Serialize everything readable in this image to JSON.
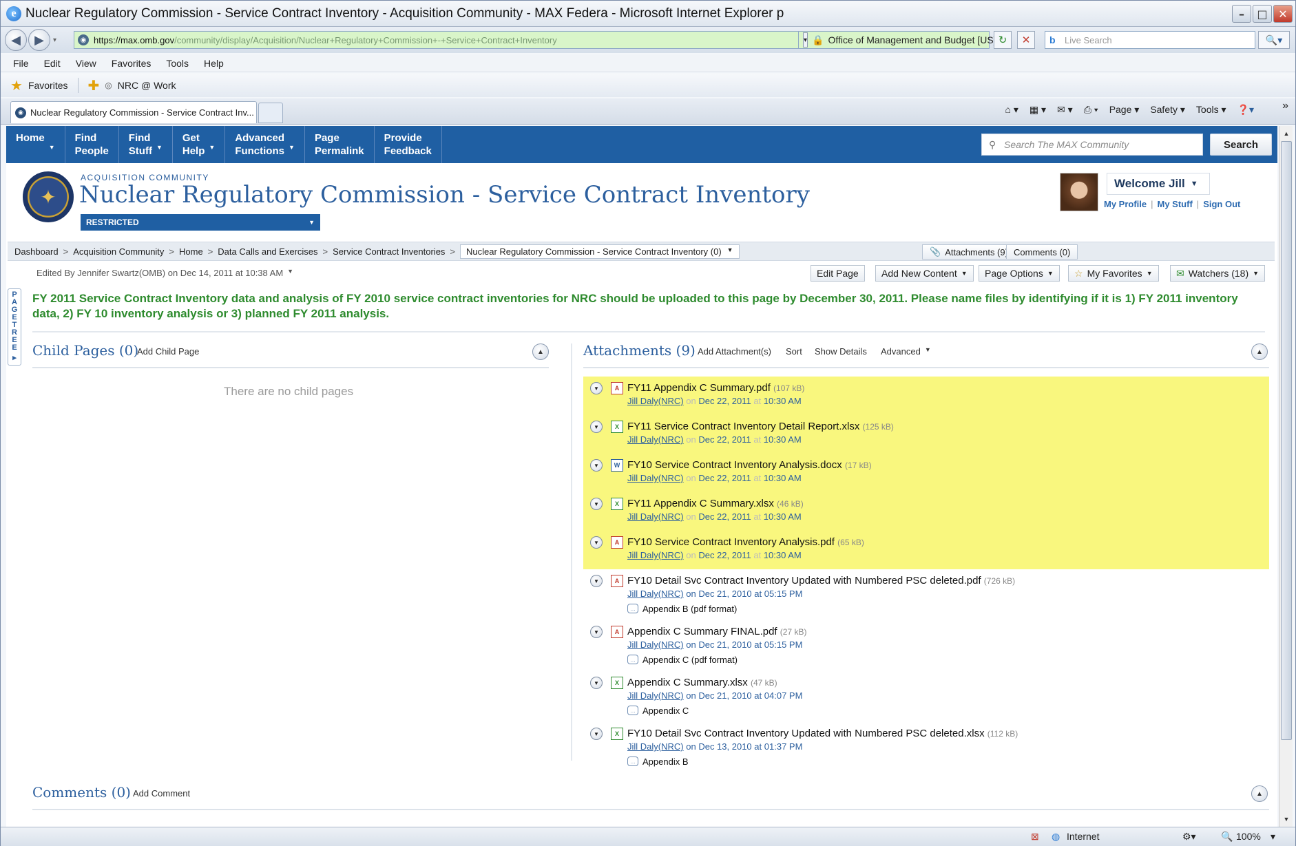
{
  "browser": {
    "title": "Nuclear Regulatory Commission - Service Contract Inventory - Acquisition Community - MAX Federa - Microsoft Internet Explorer p",
    "url_prefix": "https://",
    "url_host": "max.omb.gov",
    "url_path": "/community/display/Acquisition/Nuclear+Regulatory+Commission+-+Service+Contract+Inventory",
    "cert": "Office of Management and Budget [US]",
    "live_search_placeholder": "Live Search",
    "menu": [
      "File",
      "Edit",
      "View",
      "Favorites",
      "Tools",
      "Help"
    ],
    "favorites_label": "Favorites",
    "fav_link": "NRC @ Work",
    "tab_title": "Nuclear Regulatory Commission - Service Contract Inv...",
    "cmd": {
      "page": "Page ▾",
      "safety": "Safety ▾",
      "tools": "Tools ▾"
    },
    "status_zone": "Internet",
    "zoom": "100%"
  },
  "nav": {
    "items": [
      {
        "l1": "Home",
        "l2": "",
        "drop": true
      },
      {
        "l1": "Find",
        "l2": "People",
        "drop": false
      },
      {
        "l1": "Find",
        "l2": "Stuff",
        "drop": true
      },
      {
        "l1": "Get",
        "l2": "Help",
        "drop": true
      },
      {
        "l1": "Advanced",
        "l2": "Functions",
        "drop": true
      },
      {
        "l1": "Page",
        "l2": "Permalink",
        "drop": false
      },
      {
        "l1": "Provide",
        "l2": "Feedback",
        "drop": false
      }
    ],
    "search_placeholder": "Search The MAX Community",
    "search_button": "Search"
  },
  "header": {
    "community": "ACQUISITION COMMUNITY",
    "title": "Nuclear Regulatory Commission - Service Contract Inventory",
    "restricted": "RESTRICTED",
    "welcome": "Welcome Jill",
    "links": [
      "My Profile",
      "My Stuff",
      "Sign Out"
    ]
  },
  "breadcrumb": {
    "items": [
      "Dashboard",
      "Acquisition Community",
      "Home",
      "Data Calls and Exercises",
      "Service Contract Inventories"
    ],
    "current": "Nuclear Regulatory Commission - Service Contract Inventory (0)",
    "attachments_btn": "Attachments (9)",
    "comments_btn": "Comments (0)"
  },
  "edited_by": "Edited By Jennifer Swartz(OMB) on Dec 14, 2011 at 10:38 AM",
  "actions": {
    "edit": "Edit Page",
    "add_content": "Add New Content",
    "page_options": "Page Options",
    "favorites": "My Favorites",
    "watchers": "Watchers (18)"
  },
  "page_tree": [
    "P",
    "A",
    "G",
    "E",
    "T",
    "R",
    "E",
    "E"
  ],
  "notice": "FY 2011 Service Contract Inventory data and analysis of FY 2010 service contract inventories for NRC should be uploaded to this page by December 30, 2011. Please name files by identifying if it is 1) FY 2011 inventory data, 2) FY 10 inventory analysis or 3) planned FY 2011 analysis.",
  "child_pages": {
    "title": "Child Pages (0)",
    "add": "Add Child Page",
    "empty": "There are no child pages"
  },
  "attachments": {
    "title": "Attachments (9)",
    "add": "Add Attachment(s)",
    "sort": "Sort",
    "details": "Show Details",
    "advanced": "Advanced",
    "items": [
      {
        "name": "FY11 Appendix C Summary.pdf",
        "size": "(107 kB)",
        "type": "pdf",
        "author": "Jill Daly(NRC)",
        "on": "on",
        "date": "Dec 22, 2011",
        "at": "at",
        "time": "10:30 AM",
        "comment": "",
        "hl": true
      },
      {
        "name": "FY11 Service Contract Inventory Detail Report.xlsx",
        "size": "(125 kB)",
        "type": "xls",
        "author": "Jill Daly(NRC)",
        "on": "on",
        "date": "Dec 22, 2011",
        "at": "at",
        "time": "10:30 AM",
        "comment": "",
        "hl": true
      },
      {
        "name": "FY10 Service Contract Inventory Analysis.docx",
        "size": "(17 kB)",
        "type": "doc",
        "author": "Jill Daly(NRC)",
        "on": "on",
        "date": "Dec 22, 2011",
        "at": "at",
        "time": "10:30 AM",
        "comment": "",
        "hl": true
      },
      {
        "name": "FY11 Appendix C Summary.xlsx",
        "size": "(46 kB)",
        "type": "xls",
        "author": "Jill Daly(NRC)",
        "on": "on",
        "date": "Dec 22, 2011",
        "at": "at",
        "time": "10:30 AM",
        "comment": "",
        "hl": true
      },
      {
        "name": "FY10 Service Contract Inventory Analysis.pdf",
        "size": "(65 kB)",
        "type": "pdf",
        "author": "Jill Daly(NRC)",
        "on": "on",
        "date": "Dec 22, 2011",
        "at": "at",
        "time": "10:30 AM",
        "comment": "",
        "hl": true
      },
      {
        "name": "FY10 Detail Svc Contract Inventory Updated with Numbered PSC deleted.pdf",
        "size": "(726 kB)",
        "type": "pdf",
        "author": "Jill Daly(NRC)",
        "on": "on",
        "date": "Dec 21, 2010",
        "at": "at",
        "time": "05:15 PM",
        "comment": "Appendix B (pdf format)",
        "hl": false
      },
      {
        "name": "Appendix C Summary FINAL.pdf",
        "size": "(27 kB)",
        "type": "pdf",
        "author": "Jill Daly(NRC)",
        "on": "on",
        "date": "Dec 21, 2010",
        "at": "at",
        "time": "05:15 PM",
        "comment": "Appendix C (pdf format)",
        "hl": false
      },
      {
        "name": "Appendix C Summary.xlsx",
        "size": "(47 kB)",
        "type": "xls",
        "author": "Jill Daly(NRC)",
        "on": "on",
        "date": "Dec 21, 2010",
        "at": "at",
        "time": "04:07 PM",
        "comment": "Appendix C",
        "hl": false
      },
      {
        "name": "FY10 Detail Svc Contract Inventory Updated with Numbered PSC deleted.xlsx",
        "size": "(112 kB)",
        "type": "xls",
        "author": "Jill Daly(NRC)",
        "on": "on",
        "date": "Dec 13, 2010",
        "at": "at",
        "time": "01:37 PM",
        "comment": "Appendix B",
        "hl": false
      }
    ]
  },
  "comments": {
    "title": "Comments (0)",
    "add": "Add Comment"
  }
}
